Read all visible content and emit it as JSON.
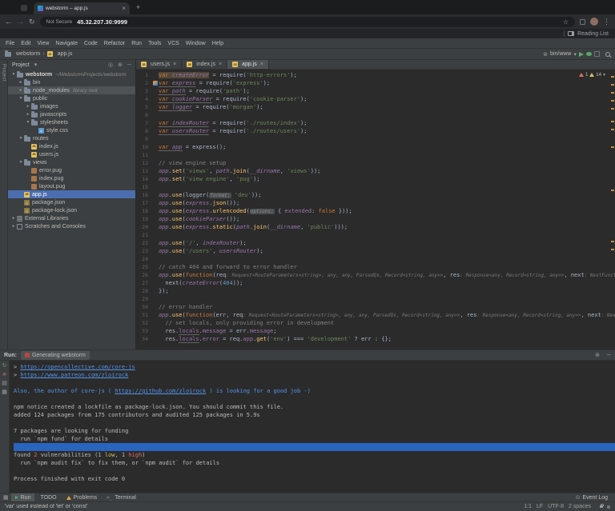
{
  "icons": {
    "close": "×",
    "plus": "+",
    "back": "←",
    "forward": "→",
    "reload": "↻",
    "star": "☆",
    "more": "⋮",
    "chevron_down": "▾",
    "chevron_right": "▸",
    "breadcrumb_sep": "›",
    "gear": "⊛",
    "minimize": "─",
    "locate": "◎",
    "terminal": ">_",
    "event_log": "⊙",
    "grid": "▦",
    "rerun": "↻",
    "stop": "■",
    "list": "▤"
  },
  "browser": {
    "tab": {
      "title": "webstorm – app.js"
    },
    "security_label": "Not Secure",
    "url": "45.32.207.30:9999",
    "reading_list": "Reading List"
  },
  "menu": {
    "items": [
      "File",
      "Edit",
      "View",
      "Navigate",
      "Code",
      "Refactor",
      "Run",
      "Tools",
      "VCS",
      "Window",
      "Help"
    ]
  },
  "navbar": {
    "project": "webstorm",
    "file": "app.js",
    "run_config": "bin/www"
  },
  "project": {
    "title": "Project",
    "tree": [
      {
        "label": "webstorm",
        "ann": "~/WebstormProjects/webstorm",
        "icon": "folder",
        "indent": 0,
        "exp": "open",
        "bold": true
      },
      {
        "label": "bin",
        "icon": "folder",
        "indent": 1,
        "exp": "closed"
      },
      {
        "label": "node_modules",
        "ann": "library root",
        "icon": "folder",
        "indent": 1,
        "exp": "closed",
        "state": "highlight"
      },
      {
        "label": "public",
        "icon": "folder",
        "indent": 1,
        "exp": "open"
      },
      {
        "label": "images",
        "icon": "folder",
        "indent": 2,
        "exp": "closed"
      },
      {
        "label": "javascripts",
        "icon": "folder",
        "indent": 2,
        "exp": "closed"
      },
      {
        "label": "stylesheets",
        "icon": "folder",
        "indent": 2,
        "exp": "open"
      },
      {
        "label": "style.css",
        "icon": "css",
        "indent": 3
      },
      {
        "label": "routes",
        "icon": "folder",
        "indent": 1,
        "exp": "open"
      },
      {
        "label": "index.js",
        "icon": "js",
        "indent": 2
      },
      {
        "label": "users.js",
        "icon": "js",
        "indent": 2
      },
      {
        "label": "views",
        "icon": "folder",
        "indent": 1,
        "exp": "open"
      },
      {
        "label": "error.pug",
        "icon": "pug",
        "indent": 2
      },
      {
        "label": "index.pug",
        "icon": "pug",
        "indent": 2
      },
      {
        "label": "layout.pug",
        "icon": "pug",
        "indent": 2
      },
      {
        "label": "app.js",
        "icon": "js",
        "indent": 1,
        "state": "selected"
      },
      {
        "label": "package.json",
        "icon": "json",
        "indent": 1
      },
      {
        "label": "package-lock.json",
        "icon": "json",
        "indent": 1
      },
      {
        "label": "External Libraries",
        "icon": "lib",
        "indent": 0,
        "exp": "closed"
      },
      {
        "label": "Scratches and Consoles",
        "icon": "scratch",
        "indent": 0,
        "exp": "closed"
      }
    ]
  },
  "editor": {
    "tabs": [
      {
        "label": "users.js"
      },
      {
        "label": "index.js"
      },
      {
        "label": "app.js",
        "active": true
      }
    ],
    "inspections": {
      "errors": "1",
      "warnings": "14"
    },
    "lines": [
      {
        "n": 1,
        "t": [
          [
            "var ",
            "k hl"
          ],
          [
            "createError",
            "v hl"
          ],
          [
            " = require(",
            "d"
          ],
          [
            "'http-errors'",
            "s"
          ],
          [
            ");",
            "d"
          ]
        ]
      },
      {
        "n": 2,
        "gicon": true,
        "t": [
          [
            "var ",
            "k u"
          ],
          [
            "express",
            "v u"
          ],
          [
            " = require(",
            "d"
          ],
          [
            "'express'",
            "s"
          ],
          [
            ");",
            "d"
          ]
        ]
      },
      {
        "n": 3,
        "t": [
          [
            "var ",
            "k u"
          ],
          [
            "path",
            "v u"
          ],
          [
            " = require(",
            "d"
          ],
          [
            "'path'",
            "s"
          ],
          [
            ");",
            "d"
          ]
        ]
      },
      {
        "n": 4,
        "t": [
          [
            "var ",
            "k u"
          ],
          [
            "cookieParser",
            "v u"
          ],
          [
            " = require(",
            "d"
          ],
          [
            "'cookie-parser'",
            "s"
          ],
          [
            ");",
            "d"
          ]
        ]
      },
      {
        "n": 5,
        "t": [
          [
            "var ",
            "k u"
          ],
          [
            "logger",
            "v u"
          ],
          [
            " = require(",
            "d"
          ],
          [
            "'morgan'",
            "s"
          ],
          [
            ");",
            "d"
          ]
        ]
      },
      {
        "n": 6,
        "t": []
      },
      {
        "n": 7,
        "t": [
          [
            "var ",
            "k u"
          ],
          [
            "indexRouter",
            "v u"
          ],
          [
            " = require(",
            "d"
          ],
          [
            "'./routes/index'",
            "s"
          ],
          [
            ");",
            "d"
          ]
        ]
      },
      {
        "n": 8,
        "t": [
          [
            "var ",
            "k u"
          ],
          [
            "usersRouter",
            "v u"
          ],
          [
            " = require(",
            "d"
          ],
          [
            "'./routes/users'",
            "s"
          ],
          [
            ");",
            "d"
          ]
        ]
      },
      {
        "n": 9,
        "t": []
      },
      {
        "n": 10,
        "t": [
          [
            "var ",
            "k u"
          ],
          [
            "app",
            "v u"
          ],
          [
            " = express();",
            "d"
          ]
        ]
      },
      {
        "n": 11,
        "t": []
      },
      {
        "n": 12,
        "t": [
          [
            "// view engine setup",
            "c"
          ]
        ]
      },
      {
        "n": 13,
        "t": [
          [
            "app",
            "v"
          ],
          [
            ".",
            "d"
          ],
          [
            "set",
            "m"
          ],
          [
            "(",
            "d"
          ],
          [
            "'views'",
            "s"
          ],
          [
            ", ",
            "d"
          ],
          [
            "path",
            "v"
          ],
          [
            ".",
            "d"
          ],
          [
            "join",
            "m"
          ],
          [
            "(",
            "d"
          ],
          [
            "__dirname",
            "v"
          ],
          [
            ", ",
            "d"
          ],
          [
            "'views'",
            "s"
          ],
          [
            "));",
            "d"
          ]
        ]
      },
      {
        "n": 14,
        "t": [
          [
            "app",
            "v"
          ],
          [
            ".",
            "d"
          ],
          [
            "set",
            "m"
          ],
          [
            "(",
            "d"
          ],
          [
            "'view engine'",
            "s"
          ],
          [
            ", ",
            "d"
          ],
          [
            "'pug'",
            "s"
          ],
          [
            ");",
            "d"
          ]
        ]
      },
      {
        "n": 15,
        "t": []
      },
      {
        "n": 16,
        "t": [
          [
            "app",
            "v"
          ],
          [
            ".",
            "d"
          ],
          [
            "use",
            "m"
          ],
          [
            "(logger(",
            "d"
          ],
          [
            "format:",
            "h"
          ],
          [
            " ",
            "d"
          ],
          [
            "'dev'",
            "s"
          ],
          [
            "));",
            "d"
          ]
        ]
      },
      {
        "n": 17,
        "t": [
          [
            "app",
            "v"
          ],
          [
            ".",
            "d"
          ],
          [
            "use",
            "m"
          ],
          [
            "(",
            "d"
          ],
          [
            "express",
            "v"
          ],
          [
            ".",
            "d"
          ],
          [
            "json",
            "m"
          ],
          [
            "());",
            "d"
          ]
        ]
      },
      {
        "n": 18,
        "t": [
          [
            "app",
            "v"
          ],
          [
            ".",
            "d"
          ],
          [
            "use",
            "m"
          ],
          [
            "(",
            "d"
          ],
          [
            "express",
            "v"
          ],
          [
            ".",
            "d"
          ],
          [
            "urlencoded",
            "m"
          ],
          [
            "(",
            "d"
          ],
          [
            "options:",
            "h"
          ],
          [
            " { ",
            "d"
          ],
          [
            "extended",
            "p"
          ],
          [
            ": ",
            "d"
          ],
          [
            "false",
            "k"
          ],
          [
            " }));",
            "d"
          ]
        ]
      },
      {
        "n": 19,
        "t": [
          [
            "app",
            "v"
          ],
          [
            ".",
            "d"
          ],
          [
            "use",
            "m"
          ],
          [
            "(",
            "d"
          ],
          [
            "cookieParser",
            "v"
          ],
          [
            "());",
            "d"
          ]
        ]
      },
      {
        "n": 20,
        "t": [
          [
            "app",
            "v"
          ],
          [
            ".",
            "d"
          ],
          [
            "use",
            "m"
          ],
          [
            "(",
            "d"
          ],
          [
            "express",
            "v"
          ],
          [
            ".",
            "d"
          ],
          [
            "static",
            "m"
          ],
          [
            "(",
            "d"
          ],
          [
            "path",
            "v"
          ],
          [
            ".",
            "d"
          ],
          [
            "join",
            "m"
          ],
          [
            "(",
            "d"
          ],
          [
            "__dirname",
            "v"
          ],
          [
            ", ",
            "d"
          ],
          [
            "'public'",
            "s"
          ],
          [
            ")));",
            "d"
          ]
        ]
      },
      {
        "n": 21,
        "t": []
      },
      {
        "n": 22,
        "t": [
          [
            "app",
            "v"
          ],
          [
            ".",
            "d"
          ],
          [
            "use",
            "m"
          ],
          [
            "(",
            "d"
          ],
          [
            "'/'",
            "s"
          ],
          [
            ", ",
            "d"
          ],
          [
            "indexRouter",
            "v"
          ],
          [
            ");",
            "d"
          ]
        ]
      },
      {
        "n": 23,
        "t": [
          [
            "app",
            "v"
          ],
          [
            ".",
            "d"
          ],
          [
            "use",
            "m"
          ],
          [
            "(",
            "d"
          ],
          [
            "'/users'",
            "s"
          ],
          [
            ", ",
            "d"
          ],
          [
            "usersRouter",
            "v"
          ],
          [
            ");",
            "d"
          ]
        ]
      },
      {
        "n": 24,
        "t": []
      },
      {
        "n": 25,
        "t": [
          [
            "// catch 404 and forward to error handler",
            "c"
          ]
        ]
      },
      {
        "n": 26,
        "t": [
          [
            "app",
            "v"
          ],
          [
            ".",
            "d"
          ],
          [
            "use",
            "m"
          ],
          [
            "(",
            "d"
          ],
          [
            "function",
            "k"
          ],
          [
            "(req",
            "d"
          ],
          [
            ": Request<RouteParameters<string>, any, any, ParsedQs, Record<string, any>>",
            "t"
          ],
          [
            ", res",
            "d"
          ],
          [
            ": Response<any, Record<string, any>>",
            "t"
          ],
          [
            ", next",
            "d"
          ],
          [
            ": NextFunction",
            "t"
          ],
          [
            ") {",
            "d"
          ]
        ]
      },
      {
        "n": 27,
        "t": [
          [
            "  next(",
            "d"
          ],
          [
            "createError",
            "v"
          ],
          [
            "(",
            "d"
          ],
          [
            "404",
            "n"
          ],
          [
            "));",
            "d"
          ]
        ]
      },
      {
        "n": 28,
        "t": [
          [
            "});",
            "d"
          ]
        ]
      },
      {
        "n": 29,
        "t": []
      },
      {
        "n": 30,
        "t": [
          [
            "// error handler",
            "c"
          ]
        ]
      },
      {
        "n": 31,
        "t": [
          [
            "app",
            "v"
          ],
          [
            ".",
            "d"
          ],
          [
            "use",
            "m"
          ],
          [
            "(",
            "d"
          ],
          [
            "function",
            "k"
          ],
          [
            "(err, req",
            "d"
          ],
          [
            ": Request<RouteParameters<string>, any, any, ParsedQs, Record<string, any>>",
            "t"
          ],
          [
            ", res",
            "d"
          ],
          [
            ": Response<any, Record<string, any>>",
            "t"
          ],
          [
            ", next",
            "d"
          ],
          [
            ": NextFunction",
            "t"
          ],
          [
            ") {",
            "d"
          ]
        ]
      },
      {
        "n": 32,
        "t": [
          [
            "  // set locals, only providing error in development",
            "c"
          ]
        ]
      },
      {
        "n": 33,
        "t": [
          [
            "  res.",
            "d"
          ],
          [
            "locals",
            "p u"
          ],
          [
            ".",
            "d"
          ],
          [
            "message",
            "p"
          ],
          [
            " = err.",
            "d"
          ],
          [
            "message",
            "p"
          ],
          [
            ";",
            "d"
          ]
        ]
      },
      {
        "n": 34,
        "t": [
          [
            "  res.",
            "d"
          ],
          [
            "locals",
            "p u"
          ],
          [
            ".",
            "d"
          ],
          [
            "error",
            "p"
          ],
          [
            " = req.",
            "d"
          ],
          [
            "app",
            "p"
          ],
          [
            ".",
            "d"
          ],
          [
            "get",
            "m"
          ],
          [
            "(",
            "d"
          ],
          [
            "'env'",
            "s"
          ],
          [
            ") === ",
            "d"
          ],
          [
            "'development'",
            "s"
          ],
          [
            " ? err : {};",
            "d"
          ]
        ]
      }
    ]
  },
  "console": {
    "title": "Run:",
    "tab_label": "Generating webstorm",
    "lines": [
      {
        "t": [
          [
            "> ",
            "cd"
          ],
          [
            "https://opencollective.com/core-js",
            "lnk"
          ]
        ]
      },
      {
        "t": [
          [
            "> ",
            "cd"
          ],
          [
            "https://www.patreon.com/zloirock",
            "lnk"
          ]
        ]
      },
      {
        "t": []
      },
      {
        "t": [
          [
            "Also, the author of core-js ( ",
            "info"
          ],
          [
            "https://github.com/zloirock",
            "lnk"
          ],
          [
            " ) is looking for a good job -)",
            "info"
          ]
        ]
      },
      {
        "t": []
      },
      {
        "t": [
          [
            "npm notice created a lockfile as package-lock.json. You should commit this file.",
            "cd"
          ]
        ]
      },
      {
        "t": [
          [
            "added 124 packages from 175 contributors and audited 125 packages in 5.9s",
            "cd"
          ]
        ]
      },
      {
        "t": []
      },
      {
        "t": [
          [
            "7 packages are looking for funding",
            "cd"
          ]
        ]
      },
      {
        "t": [
          [
            "  run `npm fund` for details",
            "cd"
          ]
        ]
      },
      {
        "sel": true,
        "t": []
      },
      {
        "t": [
          [
            "found ",
            "cd"
          ],
          [
            "2",
            "err"
          ],
          [
            " vulnerabilities (1 ",
            "cd"
          ],
          [
            "low",
            "warn"
          ],
          [
            ", 1 ",
            "cd"
          ],
          [
            "high",
            "err"
          ],
          [
            ")",
            "cd"
          ]
        ]
      },
      {
        "t": [
          [
            "  run `npm audit fix` to fix them, or `npm audit` for details",
            "cd"
          ]
        ]
      },
      {
        "t": []
      },
      {
        "t": [
          [
            "Process finished with exit code 0",
            "cd"
          ]
        ]
      }
    ]
  },
  "bottom_bar": {
    "items": [
      {
        "label": "Run",
        "icon": "play",
        "active": true
      },
      {
        "label": "TODO"
      },
      {
        "label": "Problems",
        "icon": "warn"
      },
      {
        "label": "Terminal",
        "icon": "term"
      }
    ],
    "event_log": "Event Log"
  },
  "status_bar": {
    "message": "'var' used instead of 'let' or 'const'",
    "segments": [
      "1:1",
      "LF",
      "UTF-8",
      "2 spaces"
    ]
  }
}
